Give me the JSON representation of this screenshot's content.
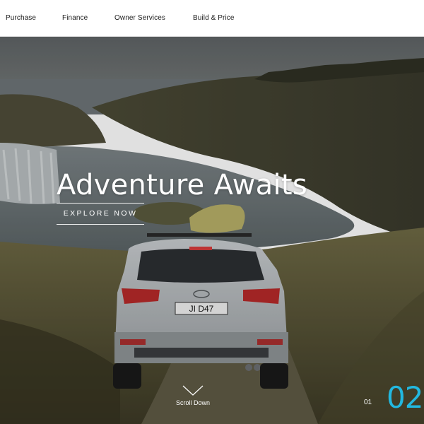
{
  "nav": {
    "items": [
      {
        "label": "Purchase"
      },
      {
        "label": "Finance"
      },
      {
        "label": "Owner Services"
      },
      {
        "label": "Build & Price"
      }
    ]
  },
  "hero": {
    "headline": "Adventure Awaits",
    "cta_label": "EXPLORE NOW",
    "scroll_label": "Scroll Down",
    "scroll_icon": "chevron-down-icon",
    "plate": "JI D47",
    "slide_prev": "01",
    "slide_current": "02"
  },
  "colors": {
    "accent": "#22b8e0",
    "nav_bg": "#ffffff",
    "nav_text": "#1c1c1c"
  }
}
